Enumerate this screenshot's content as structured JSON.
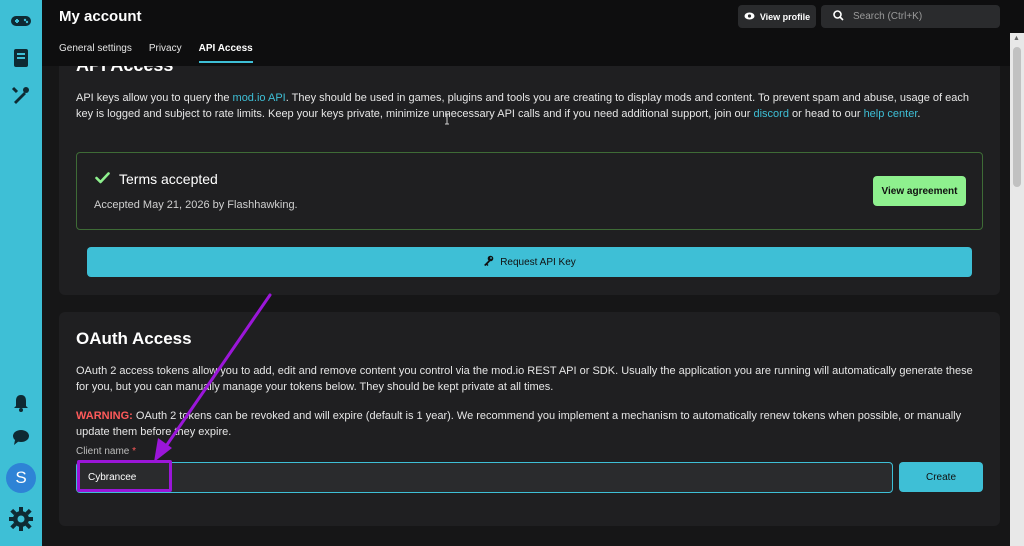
{
  "header": {
    "title": "My account",
    "view_profile": "View profile",
    "search_placeholder": "Search (Ctrl+K)"
  },
  "tabs": [
    {
      "label": "General settings",
      "active": false
    },
    {
      "label": "Privacy",
      "active": false
    },
    {
      "label": "API Access",
      "active": true
    }
  ],
  "sidebar": {
    "avatar_letter": "S",
    "icons": [
      "games-icon",
      "book-icon",
      "tools-icon",
      "bell-icon",
      "chat-icon",
      "gear-icon"
    ]
  },
  "api": {
    "title": "API Access",
    "para_pre": "API keys allow you to query the ",
    "link1": "mod.io API",
    "para_mid": ". They should be used in games, plugins and tools you are creating to display mods and content. To prevent spam and abuse, usage of each key is logged and subject to rate limits. Keep your keys private, minimize unnecessary API calls and if you need additional support, join our ",
    "link2": "discord",
    "para_mid2": " or head to our ",
    "link3": "help center",
    "para_end": ".",
    "terms_title": "Terms accepted",
    "terms_sub": "Accepted May 21, 2026 by Flashhawking.",
    "view_agreement": "View agreement",
    "request_key": "Request API Key"
  },
  "oauth": {
    "title": "OAuth Access",
    "para": "OAuth 2 access tokens allow you to add, edit and remove content you control via the mod.io REST API or SDK. Usually the application you are running will automatically generate these for you, but you can manually manage your tokens below. They should be kept private at all times.",
    "warning_label": "WARNING:",
    "warning_text": " OAuth 2 tokens can be revoked and will expire (default is 1 year). We recommend you implement a mechanism to automatically renew tokens when possible, or manually update them before they expire.",
    "client_label": "Client name",
    "required_mark": "*",
    "client_value": "Cybrancee",
    "create": "Create"
  },
  "colors": {
    "accent": "#3ebfd6",
    "success": "#8ef08e",
    "warning": "#ff5a5a",
    "annotation": "#9b16d9"
  }
}
